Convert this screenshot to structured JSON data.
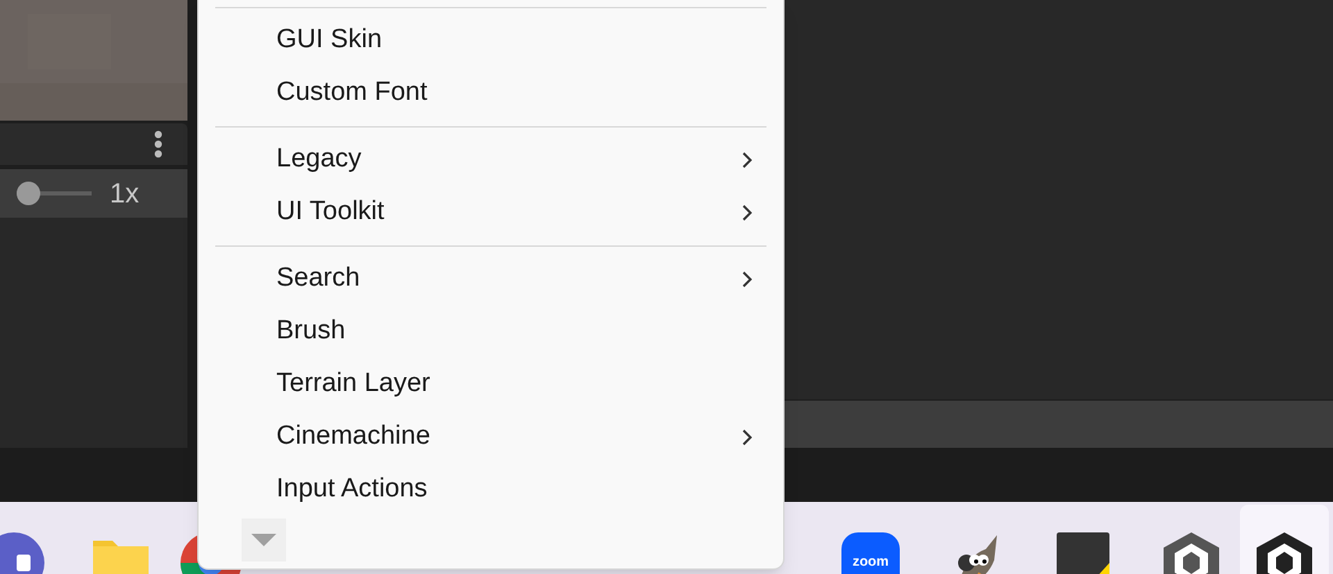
{
  "left_panel": {
    "slider": {
      "level": 0,
      "reading": "1x"
    }
  },
  "menu": {
    "items": [
      {
        "kind": "separator"
      },
      {
        "kind": "item",
        "label": "GUI Skin",
        "submenu": false
      },
      {
        "kind": "item",
        "label": "Custom Font",
        "submenu": false
      },
      {
        "kind": "separator"
      },
      {
        "kind": "item",
        "label": "Legacy",
        "submenu": true
      },
      {
        "kind": "item",
        "label": "UI Toolkit",
        "submenu": true
      },
      {
        "kind": "separator"
      },
      {
        "kind": "item",
        "label": "Search",
        "submenu": true
      },
      {
        "kind": "item",
        "label": "Brush",
        "submenu": false
      },
      {
        "kind": "item",
        "label": "Terrain Layer",
        "submenu": false
      },
      {
        "kind": "item",
        "label": "Cinemachine",
        "submenu": true
      },
      {
        "kind": "item",
        "label": "Input Actions",
        "submenu": false
      }
    ]
  },
  "taskbar": [
    {
      "kind": "video",
      "selected": false
    },
    {
      "kind": "folder",
      "selected": false
    },
    {
      "kind": "browser",
      "selected": false
    },
    {
      "kind": "zoom",
      "label": "zoom",
      "selected": false
    },
    {
      "kind": "gimp",
      "selected": false
    },
    {
      "kind": "notes",
      "selected": false
    },
    {
      "kind": "unity",
      "selected": false
    },
    {
      "kind": "unity",
      "selected": true
    }
  ]
}
